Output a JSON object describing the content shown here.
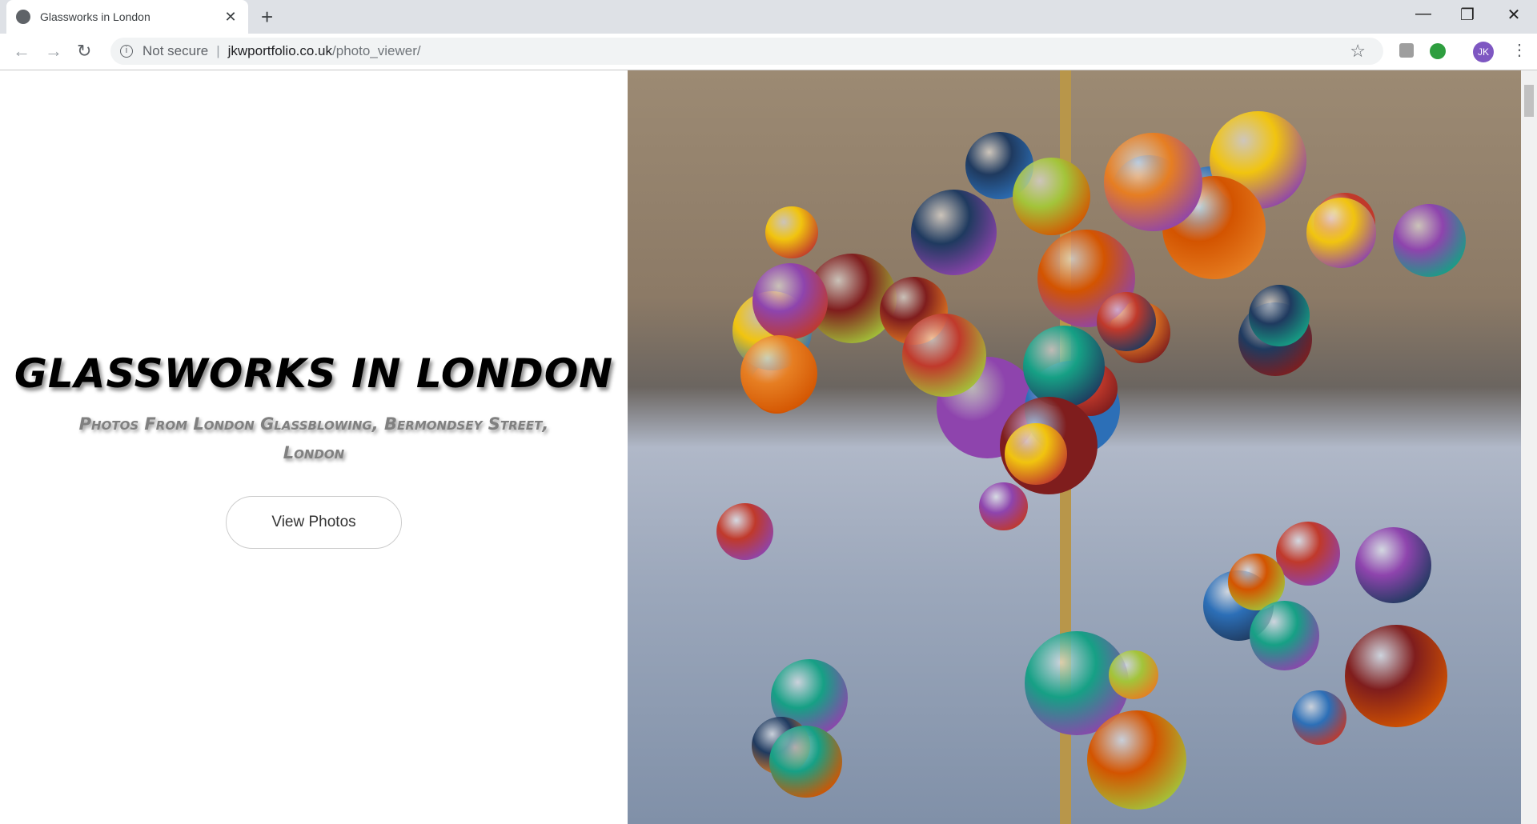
{
  "browser": {
    "tab_title": "Glassworks in London",
    "security": "Not secure",
    "url_host": "jkwportfolio.co.uk",
    "url_path": "/photo_viewer/",
    "profile_initials": "JK",
    "accent": "#7e57c2"
  },
  "page": {
    "title": "Glassworks in London",
    "subtitle": "Photos From London Glassblowing, Bermondsey Street, London",
    "button": "View Photos"
  },
  "photo": {
    "subject": "glass ornaments display"
  }
}
